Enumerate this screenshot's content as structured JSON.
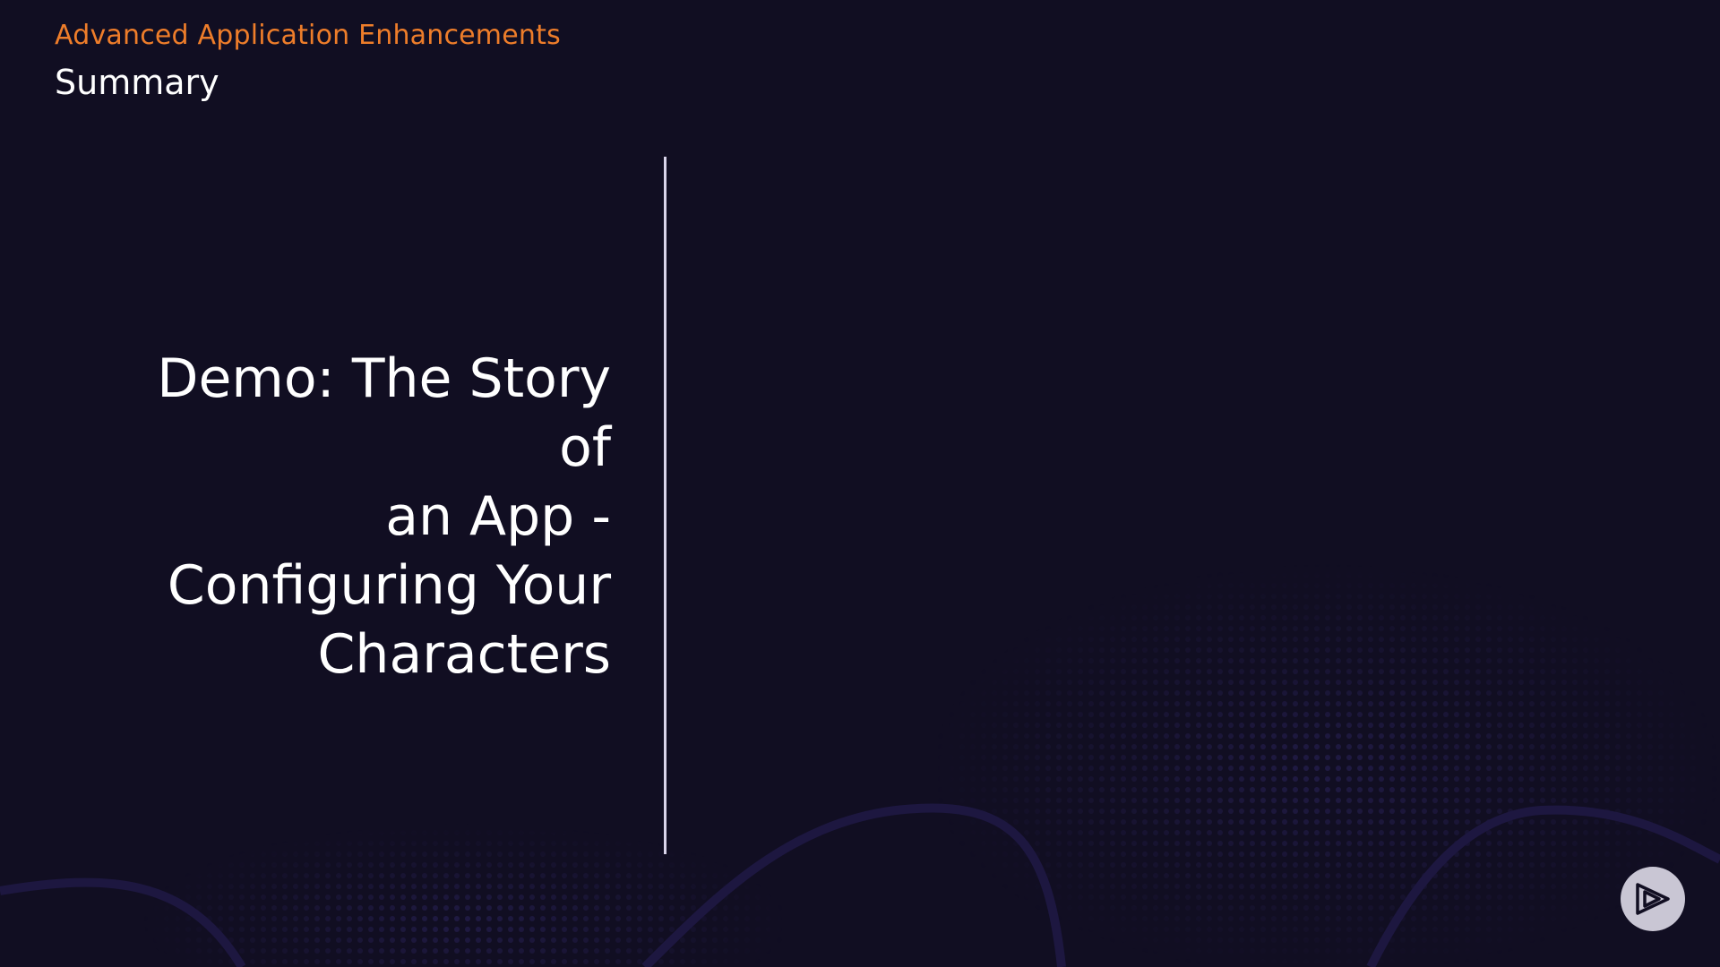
{
  "header": {
    "course_title": "Advanced Application Enhancements",
    "module_title": "Summary"
  },
  "main": {
    "demo_title_lines": [
      "Demo: The Story of",
      "an App -",
      "Configuring Your",
      "Characters"
    ]
  },
  "logo": {
    "icon": "play-logo-icon"
  },
  "colors": {
    "background": "#110e22",
    "accent": "#ee7d2a",
    "text": "#ffffff",
    "divider": "#d9d4ea",
    "logo_circle": "#c9c6d4"
  }
}
